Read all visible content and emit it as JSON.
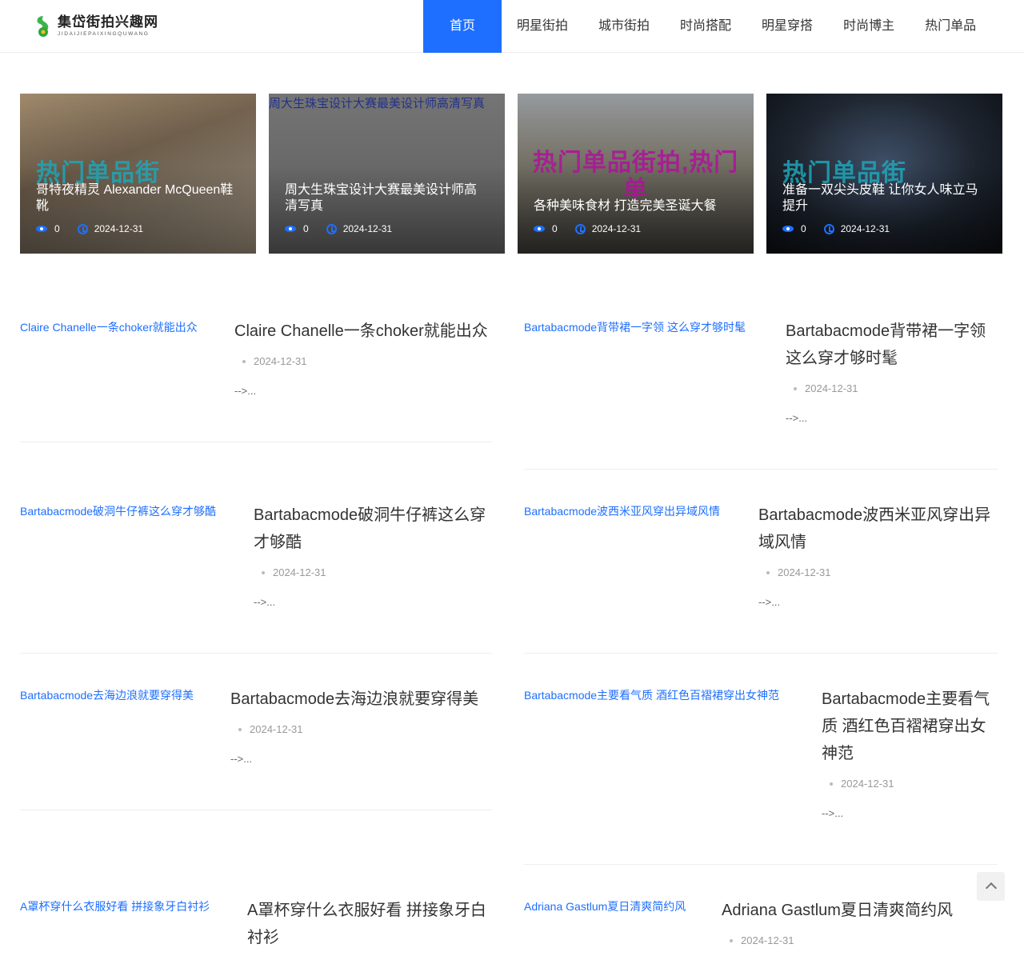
{
  "site": {
    "logo_title": "集岱街拍兴趣网",
    "logo_subtitle": "JIDAIJIEPAIXINGQUWANG"
  },
  "nav": [
    {
      "label": "首页",
      "active": true
    },
    {
      "label": "明星街拍"
    },
    {
      "label": "城市街拍"
    },
    {
      "label": "时尚搭配"
    },
    {
      "label": "明星穿搭"
    },
    {
      "label": "时尚博主"
    },
    {
      "label": "热门单品"
    }
  ],
  "featured": [
    {
      "title": "哥特夜精灵 Alexander McQueen鞋靴",
      "watermark": "热门单品街",
      "views": "0",
      "date": "2024-12-31",
      "bg": "#8d7a63"
    },
    {
      "title": "周大生珠宝设计大赛最美设计师高清写真",
      "image_alt": "周大生珠宝设计大赛最美设计师高清写真",
      "views": "0",
      "date": "2024-12-31",
      "bg": "#7a7a7a"
    },
    {
      "title": "各种美味食材 打造完美圣诞大餐",
      "watermark": "热门单品街拍,热门单",
      "views": "0",
      "date": "2024-12-31",
      "bg": "#6f6a5e"
    },
    {
      "title": "准备一双尖头皮鞋 让你女人味立马提升",
      "watermark": "热门单品街",
      "views": "0",
      "date": "2024-12-31",
      "bg": "#1a1e26"
    }
  ],
  "articles": [
    {
      "link": "Claire Chanelle一条choker就能出众",
      "title": "Claire Chanelle一条choker就能出众",
      "date": "2024-12-31",
      "excerpt": "-->..."
    },
    {
      "link": "Bartabacmode背带裙一字领 这么穿才够时髦",
      "title": "Bartabacmode背带裙一字领这么穿才够时髦",
      "date": "2024-12-31",
      "excerpt": "-->..."
    },
    {
      "link": "Bartabacmode破洞牛仔裤这么穿才够酷",
      "title": "Bartabacmode破洞牛仔裤这么穿才够酷",
      "date": "2024-12-31",
      "excerpt": "-->..."
    },
    {
      "link": "Bartabacmode波西米亚风穿出异域风情",
      "title": "Bartabacmode波西米亚风穿出异域风情",
      "date": "2024-12-31",
      "excerpt": "-->..."
    },
    {
      "link": "Bartabacmode去海边浪就要穿得美",
      "title": "Bartabacmode去海边浪就要穿得美",
      "date": "2024-12-31",
      "excerpt": "-->..."
    },
    {
      "link": "Bartabacmode主要看气质 酒红色百褶裙穿出女神范",
      "title": "Bartabacmode主要看气质 酒红色百褶裙穿出女神范",
      "date": "2024-12-31",
      "excerpt": "-->..."
    },
    {
      "link": "A罩杯穿什么衣服好看 拼接象牙白衬衫",
      "title": "A罩杯穿什么衣服好看 拼接象牙白衬衫",
      "date": "",
      "excerpt": ""
    },
    {
      "link": "Adriana Gastlum夏日清爽简约风",
      "title": "Adriana Gastlum夏日清爽简约风",
      "date": "2024-12-31",
      "excerpt": ""
    }
  ],
  "colors": {
    "accent": "#1e6fff",
    "watermark_teal": "#1ea6b8",
    "watermark_magenta": "#b0129a"
  }
}
